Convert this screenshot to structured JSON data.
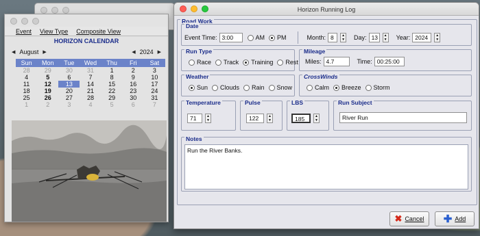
{
  "calendar_window": {
    "menu": [
      "Event",
      "View Type",
      "Composite View"
    ],
    "title": "HORIZON CALENDAR",
    "month": "August",
    "year": "2024",
    "weekdays": [
      "Sun",
      "Mon",
      "Tue",
      "Wed",
      "Thu",
      "Fri",
      "Sat"
    ],
    "days": [
      [
        "28",
        "29",
        "30",
        "31",
        "1",
        "2",
        "3"
      ],
      [
        "4",
        "5",
        "6",
        "7",
        "8",
        "9",
        "10"
      ],
      [
        "11",
        "12",
        "13",
        "14",
        "15",
        "16",
        "17"
      ],
      [
        "18",
        "19",
        "20",
        "21",
        "22",
        "23",
        "24"
      ],
      [
        "25",
        "26",
        "27",
        "28",
        "29",
        "30",
        "31"
      ],
      [
        "1",
        "2",
        "3",
        "4",
        "5",
        "6",
        "7"
      ]
    ],
    "selected_day": "13"
  },
  "log_window": {
    "title": "Horizon Running Log",
    "road_work_label": "Road Work",
    "date": {
      "label": "Date",
      "event_time_label": "Event Time:",
      "event_time": "3:00",
      "am_label": "AM",
      "pm_label": "PM",
      "selected_period": "PM",
      "month_label": "Month:",
      "month": "8",
      "day_label": "Day:",
      "day": "13",
      "year_label": "Year:",
      "year": "2024"
    },
    "run_type": {
      "label": "Run Type",
      "options": [
        "Race",
        "Track",
        "Training",
        "Rest"
      ],
      "selected": "Training"
    },
    "mileage": {
      "label": "Mileage",
      "miles_label": "Miles:",
      "miles": "4.7",
      "time_label": "Time:",
      "time": "00:25:00"
    },
    "weather": {
      "label": "Weather",
      "options": [
        "Sun",
        "Clouds",
        "Rain",
        "Snow"
      ],
      "selected": "Sun"
    },
    "crosswinds": {
      "label": "CrossWinds",
      "options": [
        "Calm",
        "Breeze",
        "Storm"
      ],
      "selected": "Breeze"
    },
    "temperature": {
      "label": "Temperature",
      "value": "71"
    },
    "pulse": {
      "label": "Pulse",
      "value": "122"
    },
    "lbs": {
      "label": "LBS",
      "value": "185"
    },
    "run_subject": {
      "label": "Run Subject",
      "value": "River Run"
    },
    "notes": {
      "label": "Notes",
      "value": "Run the River Banks."
    },
    "buttons": {
      "cancel": "Cancel",
      "add": "Add"
    },
    "colors": {
      "group_label": "#1a2c8a",
      "cancel_icon": "#d42a1a",
      "add_icon": "#2a5fcf"
    }
  }
}
